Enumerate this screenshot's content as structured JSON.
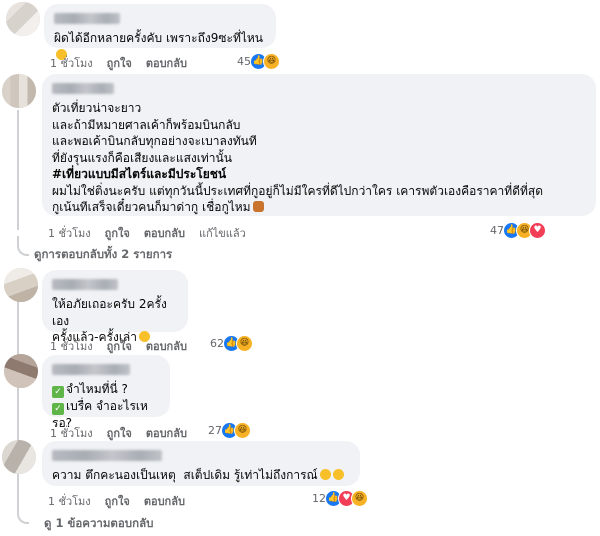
{
  "comments": [
    {
      "text": "ผิดได้อีกหลายครั้งคับ เพราะถึง9ซะที่ไหน",
      "time": "1 ชั่วโมง",
      "like": "ถูกใจ",
      "reply": "ตอบกลับ",
      "reaction_count": "45",
      "reactions": [
        "like",
        "haha"
      ]
    },
    {
      "lines": [
        "ตัวเที่ยวน่าจะยาว",
        "และถ้ามีหมายศาลเค้าก็พร้อมบินกลับ",
        "และพอเค้าบินกลับทุกอย่างจะเบาลงทันที",
        "ที่ยังรุนแรงก็คือเสียงและแสงเท่านั้น",
        "#เที่ยวแบบมีสไตร์และมีประโยชน์",
        "ผมไม่ใช่ติ่งนะครับ แต่ทุกวันนี้ประเทศที่กูอยู่ก็ไม่มีใครที่ดีไปกว่าใคร เคารพตัวเองคือราคาที่ดีที่สุด",
        "กูเน้นทีเสร็จเดี๋ยวคนก็มาด่ากู เชื่อกูไหม"
      ],
      "time": "1 ชั่วโมง",
      "like": "ถูกใจ",
      "reply": "ตอบกลับ",
      "edited": "แก้ไขแล้ว",
      "reaction_count": "47",
      "reactions": [
        "like",
        "haha",
        "love"
      ],
      "view_replies": "ดูการตอบกลับทั้ง 2 รายการ"
    },
    {
      "lines": [
        "ให้อภัยเถอะครับ 2ครั้งเอง",
        "ครั้งแล้ว-ครั้งเล่า"
      ],
      "time": "1 ชั่วโมง",
      "like": "ถูกใจ",
      "reply": "ตอบกลับ",
      "reaction_count": "62",
      "reactions": [
        "like",
        "haha"
      ]
    },
    {
      "lines": [
        "จำไหมที่นี่ ?",
        "เบรื่ค จำอะไรเหรอ?"
      ],
      "time": "1 ชั่วโมง",
      "like": "ถูกใจ",
      "reply": "ตอบกลับ",
      "reaction_count": "27",
      "reactions": [
        "like",
        "haha"
      ]
    },
    {
      "text": "ความ ตึกคะนองเป็นเหตุ  สเต็ปเดิม รู้เท่าไม่ถึงการณ์",
      "time": "1 ชั่วโมง",
      "like": "ถูกใจ",
      "reply": "ตอบกลับ",
      "reaction_count": "12",
      "reactions": [
        "like",
        "love",
        "haha"
      ],
      "view_replies": "ดู 1 ข้อความตอบกลับ"
    }
  ],
  "colors": {
    "bubble": "#f0f2f5",
    "meta": "#65676b",
    "like": "#1877f2",
    "love": "#f33e58",
    "haha": "#f7b125"
  }
}
